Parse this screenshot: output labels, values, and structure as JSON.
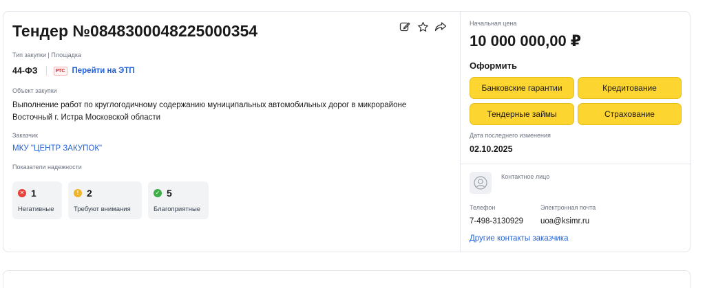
{
  "tender": {
    "title": "Тендер №0848300048225000354",
    "type_label": "Тип закупки | Площадка",
    "law": "44-ФЗ",
    "platform_badge": "РТС",
    "etp_link": "Перейти на ЭТП",
    "object_label": "Объект закупки",
    "object_text": "Выполнение работ по круглогодичному содержанию муниципальных автомобильных дорог в микрорайоне Восточный г. Истра Московской области",
    "customer_label": "Заказчик",
    "customer": "МКУ \"ЦЕНТР ЗАКУПОК\"",
    "reliability_label": "Показатели надежности",
    "reliability": [
      {
        "count": "1",
        "label": "Негативные",
        "color": "#e8413a",
        "icon": "x-icon"
      },
      {
        "count": "2",
        "label": "Требуют внимания",
        "color": "#f0b429",
        "icon": "exclamation-icon"
      },
      {
        "count": "5",
        "label": "Благоприятные",
        "color": "#3fae49",
        "icon": "check-icon"
      }
    ]
  },
  "actions": {
    "edit_icon": "edit-icon",
    "favorite_icon": "star-icon",
    "share_icon": "share-icon"
  },
  "side": {
    "price_label": "Начальная цена",
    "price": "10 000 000,00 ₽",
    "oform_title": "Оформить",
    "buttons": [
      "Банковские гарантии",
      "Кредитование",
      "Тендерные займы",
      "Страхование"
    ],
    "changed_label": "Дата последнего изменения",
    "changed_date": "02.10.2025",
    "contact_label": "Контактное лицо",
    "phone_label": "Телефон",
    "phone": "7-498-3130929",
    "email_label": "Электронная почта",
    "email": "uoa@ksimr.ru",
    "other_contacts": "Другие контакты заказчика"
  },
  "colors": {
    "accent_yellow": "#fcd531",
    "link_blue": "#2462d4"
  }
}
